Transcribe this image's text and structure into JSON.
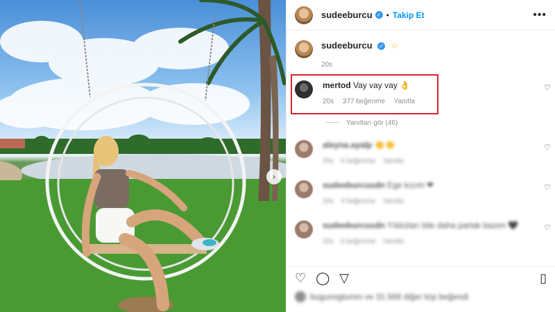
{
  "post": {
    "author": "sudeeburcu",
    "follow_label": "Takip Et",
    "dot": "•",
    "more": "•••",
    "verified_mark": "✓",
    "image_next_arrow": "›"
  },
  "caption": {
    "user": "sudeeburcu",
    "emoji": "☆",
    "time": "20s"
  },
  "highlight_comment": {
    "user": "mertod",
    "text": "Vay vay vay 👌",
    "time": "20s",
    "likes": "377 beğenme",
    "reply": "Yanıtla",
    "heart": "♡"
  },
  "view_replies": "Yanıtları gör (46)",
  "blurred_comments": [
    {
      "user": "aleyna.ayalp",
      "text": "👏👏",
      "time": "20s",
      "likes": "6 beğenme",
      "reply": "Yanıtla",
      "heart": "♡"
    },
    {
      "user": "sudeeburcuudn",
      "text": "Ege kızım ❤",
      "time": "20s",
      "likes": "4 beğenme",
      "reply": "Yanıtla",
      "heart": "♡"
    },
    {
      "user": "sudeeburcuudn",
      "text": "Yıldızları bile daha parlak bazen 🖤",
      "time": "20s",
      "likes": "6 beğenme",
      "reply": "Yanıtla",
      "heart": "♡"
    }
  ],
  "actions": {
    "like_icon": "♡",
    "comment_icon": "◯",
    "share_icon": "▽",
    "save_icon": "▯"
  },
  "likes_line": "bugunoglumin ve 31.566 diğer kişi beğendi"
}
